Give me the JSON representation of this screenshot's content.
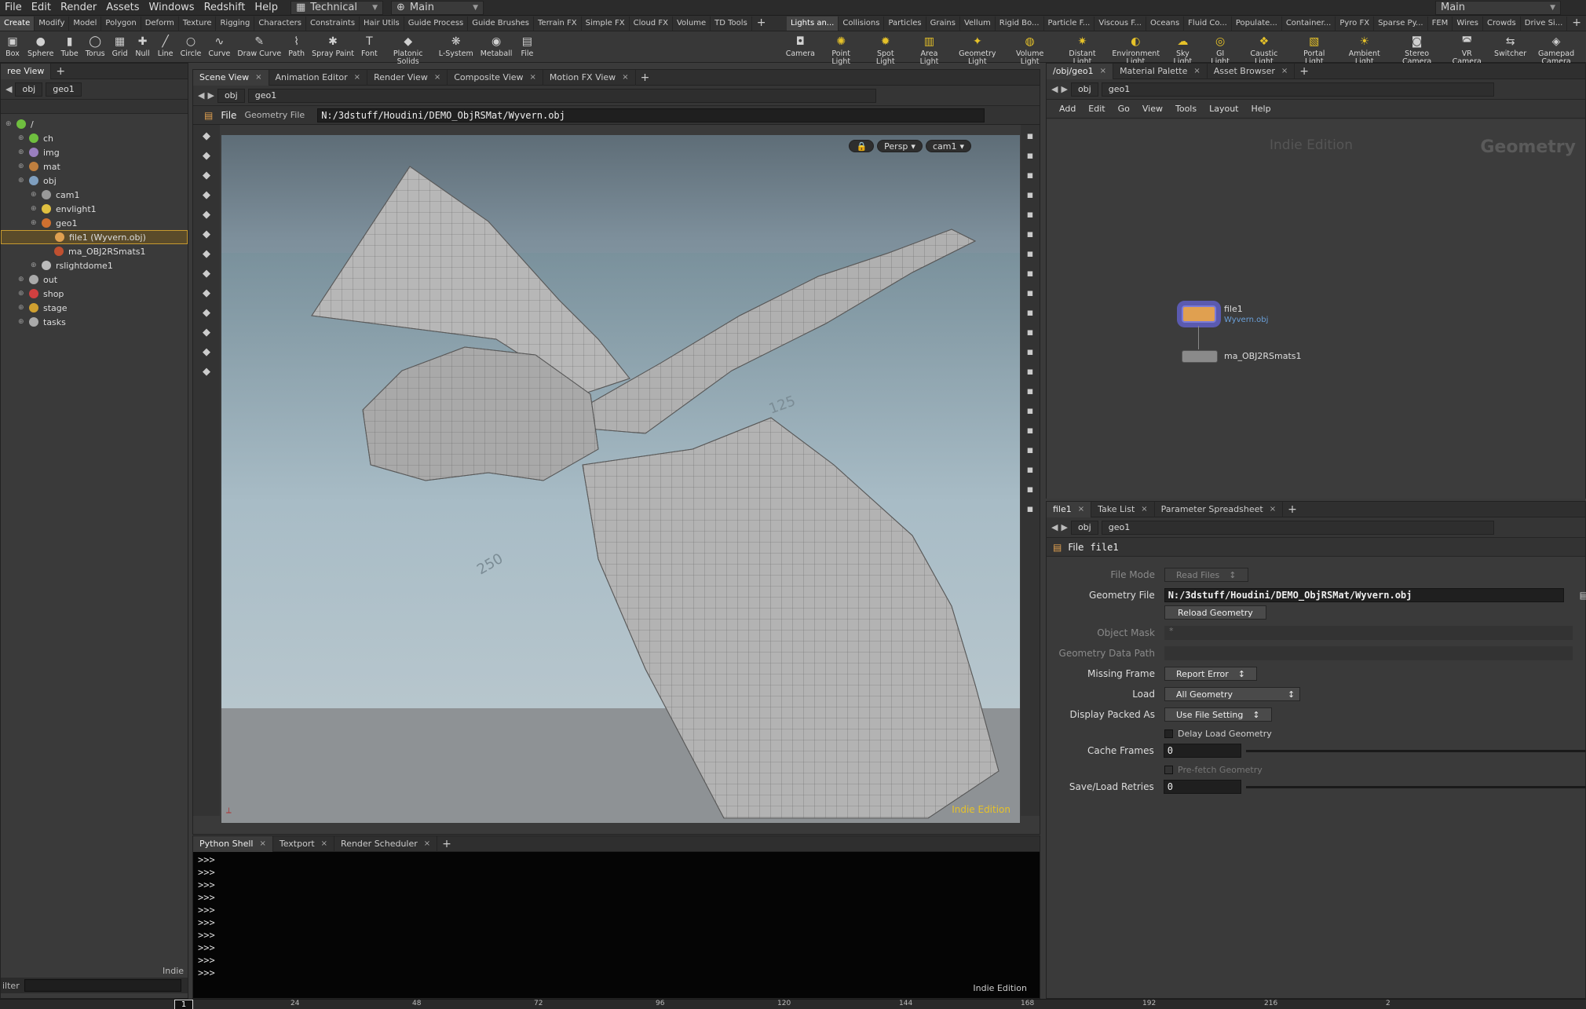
{
  "menubar": {
    "items": [
      "File",
      "Edit",
      "Render",
      "Assets",
      "Windows",
      "Redshift",
      "Help"
    ],
    "desktop": "Technical",
    "context": "Main",
    "right_context": "Main"
  },
  "shelf_tabs_left": [
    "Create",
    "Modify",
    "Model",
    "Polygon",
    "Deform",
    "Texture",
    "Rigging",
    "Characters",
    "Constraints",
    "Hair Utils",
    "Guide Process",
    "Guide Brushes",
    "Terrain FX",
    "Simple FX",
    "Cloud FX",
    "Volume",
    "TD Tools"
  ],
  "shelf_tabs_right": [
    "Lights an...",
    "Collisions",
    "Particles",
    "Grains",
    "Vellum",
    "Rigid Bo...",
    "Particle F...",
    "Viscous F...",
    "Oceans",
    "Fluid Co...",
    "Populate...",
    "Container...",
    "Pyro FX",
    "Sparse Py...",
    "FEM",
    "Wires",
    "Crowds",
    "Drive Si..."
  ],
  "shelf_tools_left": [
    {
      "label": "Box",
      "icon": "box-icon"
    },
    {
      "label": "Sphere",
      "icon": "sphere-icon"
    },
    {
      "label": "Tube",
      "icon": "tube-icon"
    },
    {
      "label": "Torus",
      "icon": "torus-icon"
    },
    {
      "label": "Grid",
      "icon": "grid-icon"
    },
    {
      "label": "Null",
      "icon": "null-icon"
    },
    {
      "label": "Line",
      "icon": "line-icon"
    },
    {
      "label": "Circle",
      "icon": "circle-icon"
    },
    {
      "label": "Curve",
      "icon": "curve-icon"
    },
    {
      "label": "Draw Curve",
      "icon": "draw-curve-icon"
    },
    {
      "label": "Path",
      "icon": "path-icon"
    },
    {
      "label": "Spray Paint",
      "icon": "spray-paint-icon"
    },
    {
      "label": "Font",
      "icon": "font-icon"
    },
    {
      "label": "Platonic Solids",
      "icon": "platonic-icon"
    },
    {
      "label": "L-System",
      "icon": "lsystem-icon"
    },
    {
      "label": "Metaball",
      "icon": "metaball-icon"
    },
    {
      "label": "File",
      "icon": "file-icon"
    }
  ],
  "shelf_tools_right": [
    {
      "label": "Camera",
      "icon": "camera-icon"
    },
    {
      "label": "Point Light",
      "icon": "point-light-icon"
    },
    {
      "label": "Spot Light",
      "icon": "spot-light-icon"
    },
    {
      "label": "Area Light",
      "icon": "area-light-icon"
    },
    {
      "label": "Geometry Light",
      "icon": "geometry-light-icon"
    },
    {
      "label": "Volume Light",
      "icon": "volume-light-icon"
    },
    {
      "label": "Distant Light",
      "icon": "distant-light-icon"
    },
    {
      "label": "Environment Light",
      "icon": "environment-light-icon"
    },
    {
      "label": "Sky Light",
      "icon": "sky-light-icon"
    },
    {
      "label": "GI Light",
      "icon": "gi-light-icon"
    },
    {
      "label": "Caustic Light",
      "icon": "caustic-light-icon"
    },
    {
      "label": "Portal Light",
      "icon": "portal-light-icon"
    },
    {
      "label": "Ambient Light",
      "icon": "ambient-light-icon"
    },
    {
      "label": "Stereo Camera",
      "icon": "stereo-camera-icon"
    },
    {
      "label": "VR Camera",
      "icon": "vr-camera-icon"
    },
    {
      "label": "Switcher",
      "icon": "switcher-icon"
    },
    {
      "label": "Gamepad Camera",
      "icon": "gamepad-camera-icon"
    }
  ],
  "tree": {
    "tab": "ree View",
    "path_obj": "obj",
    "path_geo": "geo1",
    "rows": [
      {
        "label": "/",
        "indent": 0,
        "color": "#6fbf3f"
      },
      {
        "label": "ch",
        "indent": 1,
        "color": "#6fbf3f"
      },
      {
        "label": "img",
        "indent": 1,
        "color": "#9a7fbf"
      },
      {
        "label": "mat",
        "indent": 1,
        "color": "#bf7f3f"
      },
      {
        "label": "obj",
        "indent": 1,
        "color": "#7f9fbf"
      },
      {
        "label": "cam1",
        "indent": 2,
        "color": "#999999"
      },
      {
        "label": "envlight1",
        "indent": 2,
        "color": "#e0c040"
      },
      {
        "label": "geo1",
        "indent": 2,
        "color": "#d07030"
      },
      {
        "label": "file1 (Wyvern.obj)",
        "indent": 3,
        "color": "#e0a050",
        "selected": true
      },
      {
        "label": "ma_OBJ2RSmats1",
        "indent": 3,
        "color": "#c05030"
      },
      {
        "label": "rslightdome1",
        "indent": 2,
        "color": "#bbbbbb"
      },
      {
        "label": "out",
        "indent": 1,
        "color": "#aaaaaa"
      },
      {
        "label": "shop",
        "indent": 1,
        "color": "#d04040"
      },
      {
        "label": "stage",
        "indent": 1,
        "color": "#d0a030"
      },
      {
        "label": "tasks",
        "indent": 1,
        "color": "#aaaaaa"
      }
    ],
    "footer": "Indie",
    "filter_label": "ilter"
  },
  "viewer": {
    "tabs": [
      "Scene View",
      "Animation Editor",
      "Render View",
      "Composite View",
      "Motion FX View"
    ],
    "path_obj": "obj",
    "path_geo": "geo1",
    "op_label": "File",
    "op_type": "Geometry File",
    "op_path": "N:/3dstuff/Houdini/DEMO_ObjRSMat/Wyvern.obj",
    "persp": "Persp",
    "cam": "cam1",
    "watermark": "Indie Edition",
    "grid_labels": [
      "125",
      "250",
      "125",
      "250"
    ]
  },
  "shell": {
    "tabs": [
      "Python Shell",
      "Textport",
      "Render Scheduler"
    ],
    "prompt": ">>>",
    "lines": 10,
    "watermark": "Indie Edition"
  },
  "network": {
    "tabs": [
      "/obj/geo1",
      "Material Palette",
      "Asset Browser"
    ],
    "path_obj": "obj",
    "path_geo": "geo1",
    "menu": [
      "Add",
      "Edit",
      "Go",
      "View",
      "Tools",
      "Layout",
      "Help"
    ],
    "edition": "Indie Edition",
    "context_label": "Geometry",
    "nodes": [
      {
        "name": "file1",
        "sub": "Wyvern.obj"
      },
      {
        "name": "ma_OBJ2RSmats1",
        "sub": ""
      }
    ]
  },
  "params": {
    "tabs": [
      "file1",
      "Take List",
      "Parameter Spreadsheet"
    ],
    "path_obj": "obj",
    "path_geo": "geo1",
    "op_label": "File",
    "node_name": "file1",
    "file_mode_label": "File Mode",
    "file_mode": "Read Files",
    "geometry_file_label": "Geometry File",
    "geometry_file": "N:/3dstuff/Houdini/DEMO_ObjRSMat/Wyvern.obj",
    "reload_label": "Reload Geometry",
    "object_mask_label": "Object Mask",
    "object_mask": "*",
    "data_path_label": "Geometry Data Path",
    "missing_frame_label": "Missing Frame",
    "missing_frame": "Report Error",
    "load_label": "Load",
    "load": "All Geometry",
    "packed_label": "Display Packed As",
    "packed": "Use File Setting",
    "delay_label": "Delay Load Geometry",
    "cache_label": "Cache Frames",
    "cache": "0",
    "prefetch_label": "Pre-fetch Geometry",
    "retries_label": "Save/Load Retries",
    "retries": "0"
  },
  "timeline": {
    "frame": "1",
    "ticks": [
      "24",
      "48",
      "72",
      "96",
      "120",
      "144",
      "168",
      "192",
      "216",
      "2"
    ]
  },
  "colors": {
    "accent": "#e6c229",
    "selection": "#c79a2f"
  }
}
